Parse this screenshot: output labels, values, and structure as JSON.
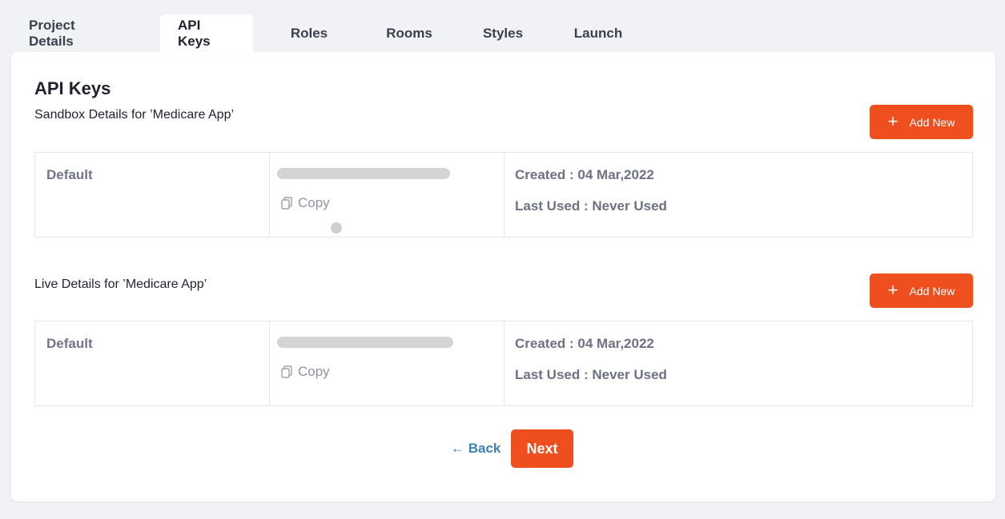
{
  "tabs": [
    {
      "label": "Project Details"
    },
    {
      "label": "API Keys"
    },
    {
      "label": "Roles"
    },
    {
      "label": "Rooms"
    },
    {
      "label": "Styles"
    },
    {
      "label": "Launch"
    }
  ],
  "active_tab": "API Keys",
  "page": {
    "title": "API Keys"
  },
  "sandbox": {
    "label": "Sandbox Details for ’Medicare App’",
    "add_label": "Add New",
    "row": {
      "name": "Default",
      "copy_label": "Copy",
      "created": "Created : 04 Mar,2022",
      "last_used": "Last Used : Never Used"
    }
  },
  "live": {
    "label": "Live Details for ’Medicare App’",
    "add_label": "Add New",
    "row": {
      "name": "Default",
      "copy_label": "Copy",
      "created": "Created : 04 Mar,2022",
      "last_used": "Last Used : Never Used"
    }
  },
  "footer": {
    "back_label": "← Back",
    "next_label": "Next"
  },
  "colors": {
    "accent": "#ef4f1f",
    "link": "#3b82b5",
    "muted_text": "#6c7184",
    "background": "#f0f2f6"
  },
  "icons": {
    "add": "plus-icon",
    "copy": "copy-icon"
  }
}
